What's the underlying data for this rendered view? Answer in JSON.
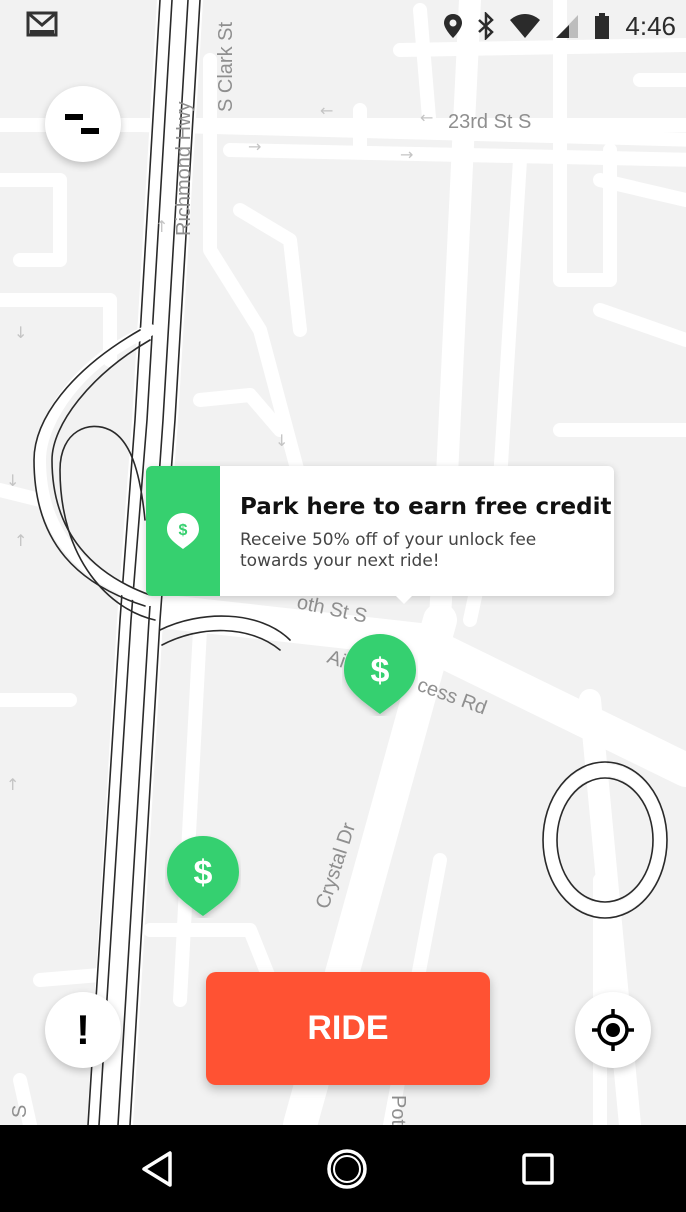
{
  "status_bar": {
    "time": "4:46",
    "left_icon": "gmail-icon",
    "icons": [
      "location-pin-icon",
      "bluetooth-icon",
      "wifi-icon",
      "signal-icon",
      "battery-icon"
    ]
  },
  "map": {
    "street_labels": [
      "S Clark St",
      "Richmond Hwy",
      "23rd St S",
      "Crystal Dr",
      "S",
      "Pot"
    ],
    "partial_labels": [
      "Ai",
      "cess Rd",
      "oth St S"
    ]
  },
  "menu_button": {
    "icon": "menu-icon"
  },
  "promo": {
    "title": "Park here to earn free credit!",
    "body": "Receive 50% off of your unlock fee towards your next ride!",
    "icon_glyph": "$",
    "color": "#36d06f"
  },
  "pins": [
    {
      "glyph": "$",
      "color": "#36d06f"
    },
    {
      "glyph": "$",
      "color": "#36d06f"
    }
  ],
  "report_button": {
    "icon": "exclamation-icon",
    "glyph": "!"
  },
  "ride_button": {
    "label": "RIDE",
    "color": "#ff5233"
  },
  "locate_button": {
    "icon": "crosshair-icon"
  },
  "nav_bar": {
    "icons": [
      "back-icon",
      "home-icon",
      "recents-icon"
    ]
  }
}
